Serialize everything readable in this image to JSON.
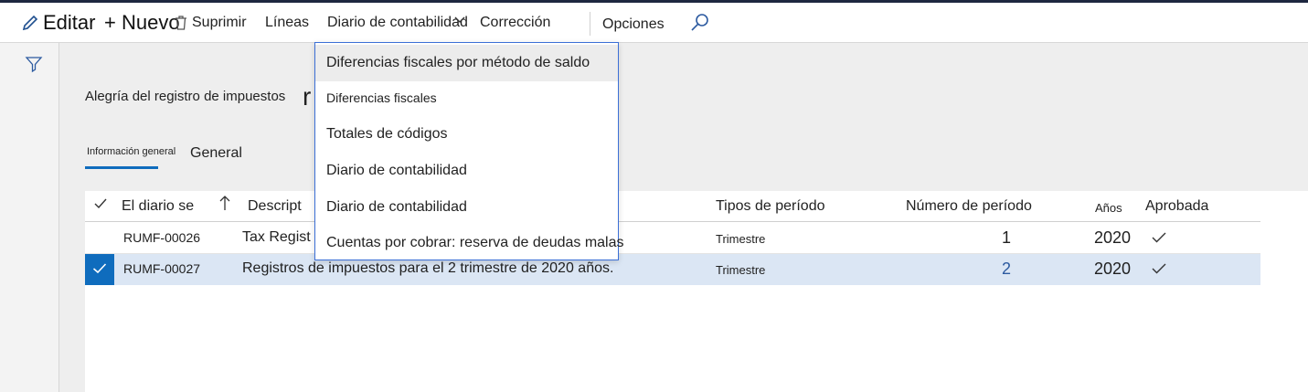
{
  "toolbar": {
    "edit_label": "Editar",
    "new_label": "+ Nuevo",
    "delete_label": "Suprimir",
    "lines_label": "Líneas",
    "ledger_label": "Diario de contabilidad",
    "correction_label": "Corrección",
    "options_label": "Opciones",
    "icons": [
      "pencil-icon",
      "trash-icon",
      "chevron-down-icon",
      "search-icon"
    ]
  },
  "left_rail": {
    "icons": [
      "filter-icon"
    ]
  },
  "page": {
    "title": "Alegría del registro de impuestos",
    "title_fragment": "r"
  },
  "tabs": [
    {
      "label": "Información general"
    },
    {
      "label": "General"
    }
  ],
  "grid": {
    "columns": [
      "El diario se",
      "Descript",
      "Tipos de período",
      "Número de período",
      "Años",
      "Aprobada"
    ],
    "sort_icon": "arrow-up-icon",
    "rows": [
      {
        "journal": "RUMF-00026",
        "description": "Tax Regist",
        "period_type": "Trimestre",
        "period_number": "1",
        "year": "2020",
        "approved": true,
        "selected": false
      },
      {
        "journal": "RUMF-00027",
        "description": "Registros de impuestos para el 2 trimestre de 2020 años.",
        "period_type": "Trimestre",
        "period_number": "2",
        "year": "2020",
        "approved": true,
        "selected": true
      }
    ]
  },
  "dropdown": {
    "items": [
      {
        "label": "Diferencias fiscales por método de saldo"
      },
      {
        "label": "Diferencias fiscales"
      },
      {
        "label": "Totales de códigos"
      },
      {
        "label": "Diario de contabilidad"
      },
      {
        "label": "Diario de contabilidad"
      },
      {
        "label": "Cuentas por cobrar: reserva de deudas malas"
      }
    ]
  },
  "colors": {
    "accent": "#0f6cbd",
    "selected_row": "#dbe6f4",
    "dropdown_border": "#3b6fd6",
    "highlight": "#ececec"
  }
}
